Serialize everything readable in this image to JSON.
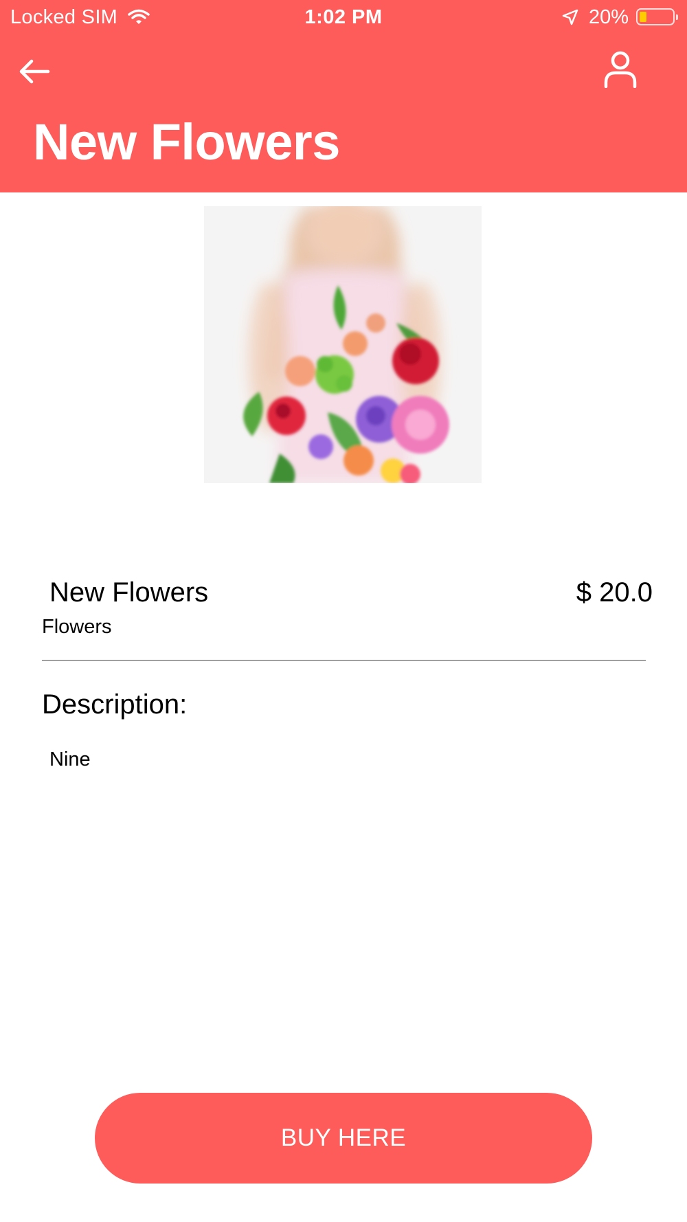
{
  "status_bar": {
    "carrier": "Locked SIM",
    "time": "1:02 PM",
    "battery_percent": "20%",
    "battery_level": 0.2,
    "icons": [
      "wifi-icon",
      "location-arrow-icon",
      "battery-icon"
    ]
  },
  "header": {
    "title": "New Flowers",
    "background_color": "#fd5c5a",
    "icons": [
      "back-arrow-icon",
      "user-profile-icon"
    ]
  },
  "product": {
    "image_subject": "flower-bouquet",
    "name": "New Flowers",
    "price": "$ 20.0",
    "category": "Flowers"
  },
  "description": {
    "heading": "Description:",
    "text": "Nine"
  },
  "actions": {
    "buy_label": "BUY HERE",
    "button_color": "#fd5c5a"
  }
}
